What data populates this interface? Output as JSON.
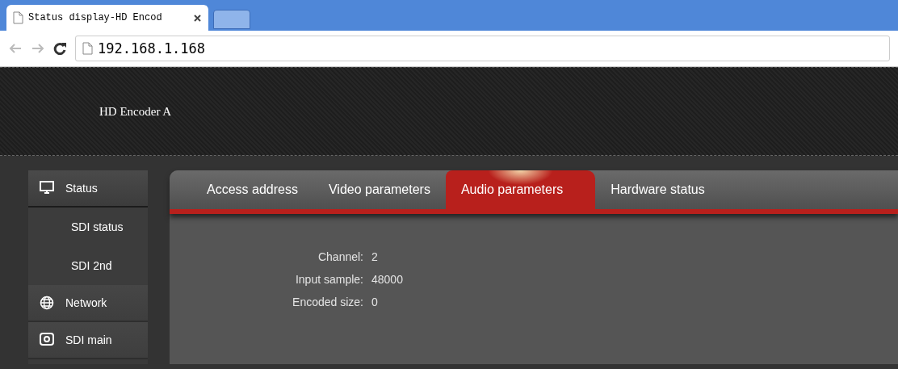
{
  "browser": {
    "tab_title": "Status display-HD Encod",
    "address": "192.168.1.168"
  },
  "header": {
    "title": "HD Encoder A"
  },
  "sidebar": {
    "items": [
      {
        "label": "Status",
        "expanded": true,
        "children": [
          {
            "label": "SDI status"
          },
          {
            "label": "SDI 2nd"
          }
        ]
      },
      {
        "label": "Network",
        "expanded": false
      },
      {
        "label": "SDI main",
        "expanded": false
      }
    ]
  },
  "tabs": [
    {
      "label": "Access address",
      "selected": false
    },
    {
      "label": "Video parameters",
      "selected": false
    },
    {
      "label": "Audio parameters",
      "selected": true
    },
    {
      "label": "Hardware status",
      "selected": false
    }
  ],
  "fields": [
    {
      "label": "Channel:",
      "value": "2"
    },
    {
      "label": "Input sample:",
      "value": "48000"
    },
    {
      "label": "Encoded size:",
      "value": "0"
    }
  ]
}
